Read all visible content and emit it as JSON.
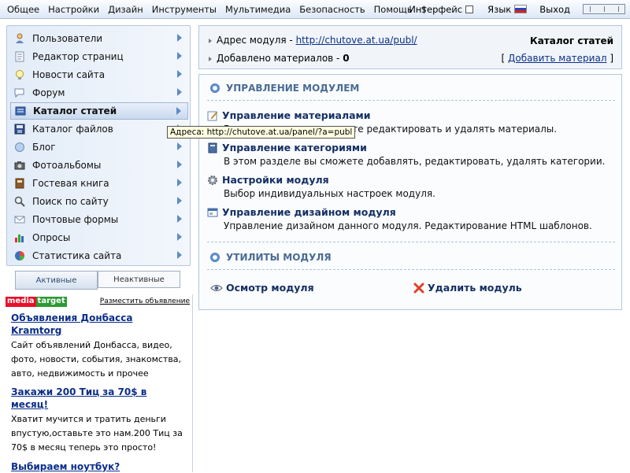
{
  "topbar": {
    "menu": [
      "Общее",
      "Настройки",
      "Дизайн",
      "Инструменты",
      "Мультимедиа",
      "Безопасность",
      "Помощь",
      "$"
    ],
    "interface_label": "Интерфейс",
    "language_label": "Язык",
    "logout_label": "Выход"
  },
  "sidebar": {
    "items": [
      {
        "label": "Пользователи",
        "icon": "users-icon"
      },
      {
        "label": "Редактор страниц",
        "icon": "page-editor-icon"
      },
      {
        "label": "Новости сайта",
        "icon": "news-icon"
      },
      {
        "label": "Форум",
        "icon": "forum-icon"
      },
      {
        "label": "Каталог статей",
        "icon": "articles-icon",
        "active": true
      },
      {
        "label": "Каталог файлов",
        "icon": "files-icon"
      },
      {
        "label": "Блог",
        "icon": "blog-icon"
      },
      {
        "label": "Фотоальбомы",
        "icon": "camera-icon"
      },
      {
        "label": "Гостевая книга",
        "icon": "guestbook-icon"
      },
      {
        "label": "Поиск по сайту",
        "icon": "search-icon"
      },
      {
        "label": "Почтовые формы",
        "icon": "mail-icon"
      },
      {
        "label": "Опросы",
        "icon": "poll-icon"
      },
      {
        "label": "Статистика сайта",
        "icon": "stats-icon"
      }
    ],
    "tabs": {
      "active": "Активные",
      "inactive": "Неактивные"
    }
  },
  "ads": {
    "brand_a": "media",
    "brand_b": "target",
    "place_link": "Разместить объявление",
    "items": [
      {
        "title": "Объявления Донбасса Kramtorg",
        "body": "Сайт объявлений Донбасса, видео, фото, новости, события, знакомства, авто, недвижимость и прочее"
      },
      {
        "title": "Закажи 200 Тиц за 70$ в месяц!",
        "body": "Хватит мучится и тратить деньги впустую,оставьте это нам.200 Тиц за 70$ в месяц теперь это просто!"
      },
      {
        "title": "Выбираем ноутбук?",
        "body": ""
      }
    ]
  },
  "info": {
    "address_label": "Адрес модуля - ",
    "address_link": "http://chutove.at.ua/publ/",
    "materials_label": "Добавлено материалов - ",
    "materials_count": "0",
    "module_title": "Каталог статей",
    "add_bracket_open": "[",
    "add_link": "Добавить материал",
    "add_bracket_close": "]"
  },
  "management": {
    "section_title": "УПРАВЛЕНИЕ МОДУЛЕМ",
    "items": [
      {
        "title": "Управление материалами",
        "desc": "В этом разделе вы сможете редактировать и удалять материалы."
      },
      {
        "title": "Управление категориями",
        "desc": "В этом разделе вы сможете добавлять, редактировать, удалять категории."
      },
      {
        "title": "Настройки модуля",
        "desc": "Выбор индивидуальных настроек модуля."
      },
      {
        "title": "Управление дизайном модуля",
        "desc": "Управление дизайном данного модуля. Редактирование HTML шаблонов."
      }
    ],
    "utils_title": "УТИЛИТЫ МОДУЛЯ",
    "inspect": "Осмотр модуля",
    "delete": "Удалить модуль"
  },
  "tooltip": "Адреса: http://chutove.at.ua/panel/?a=publ"
}
